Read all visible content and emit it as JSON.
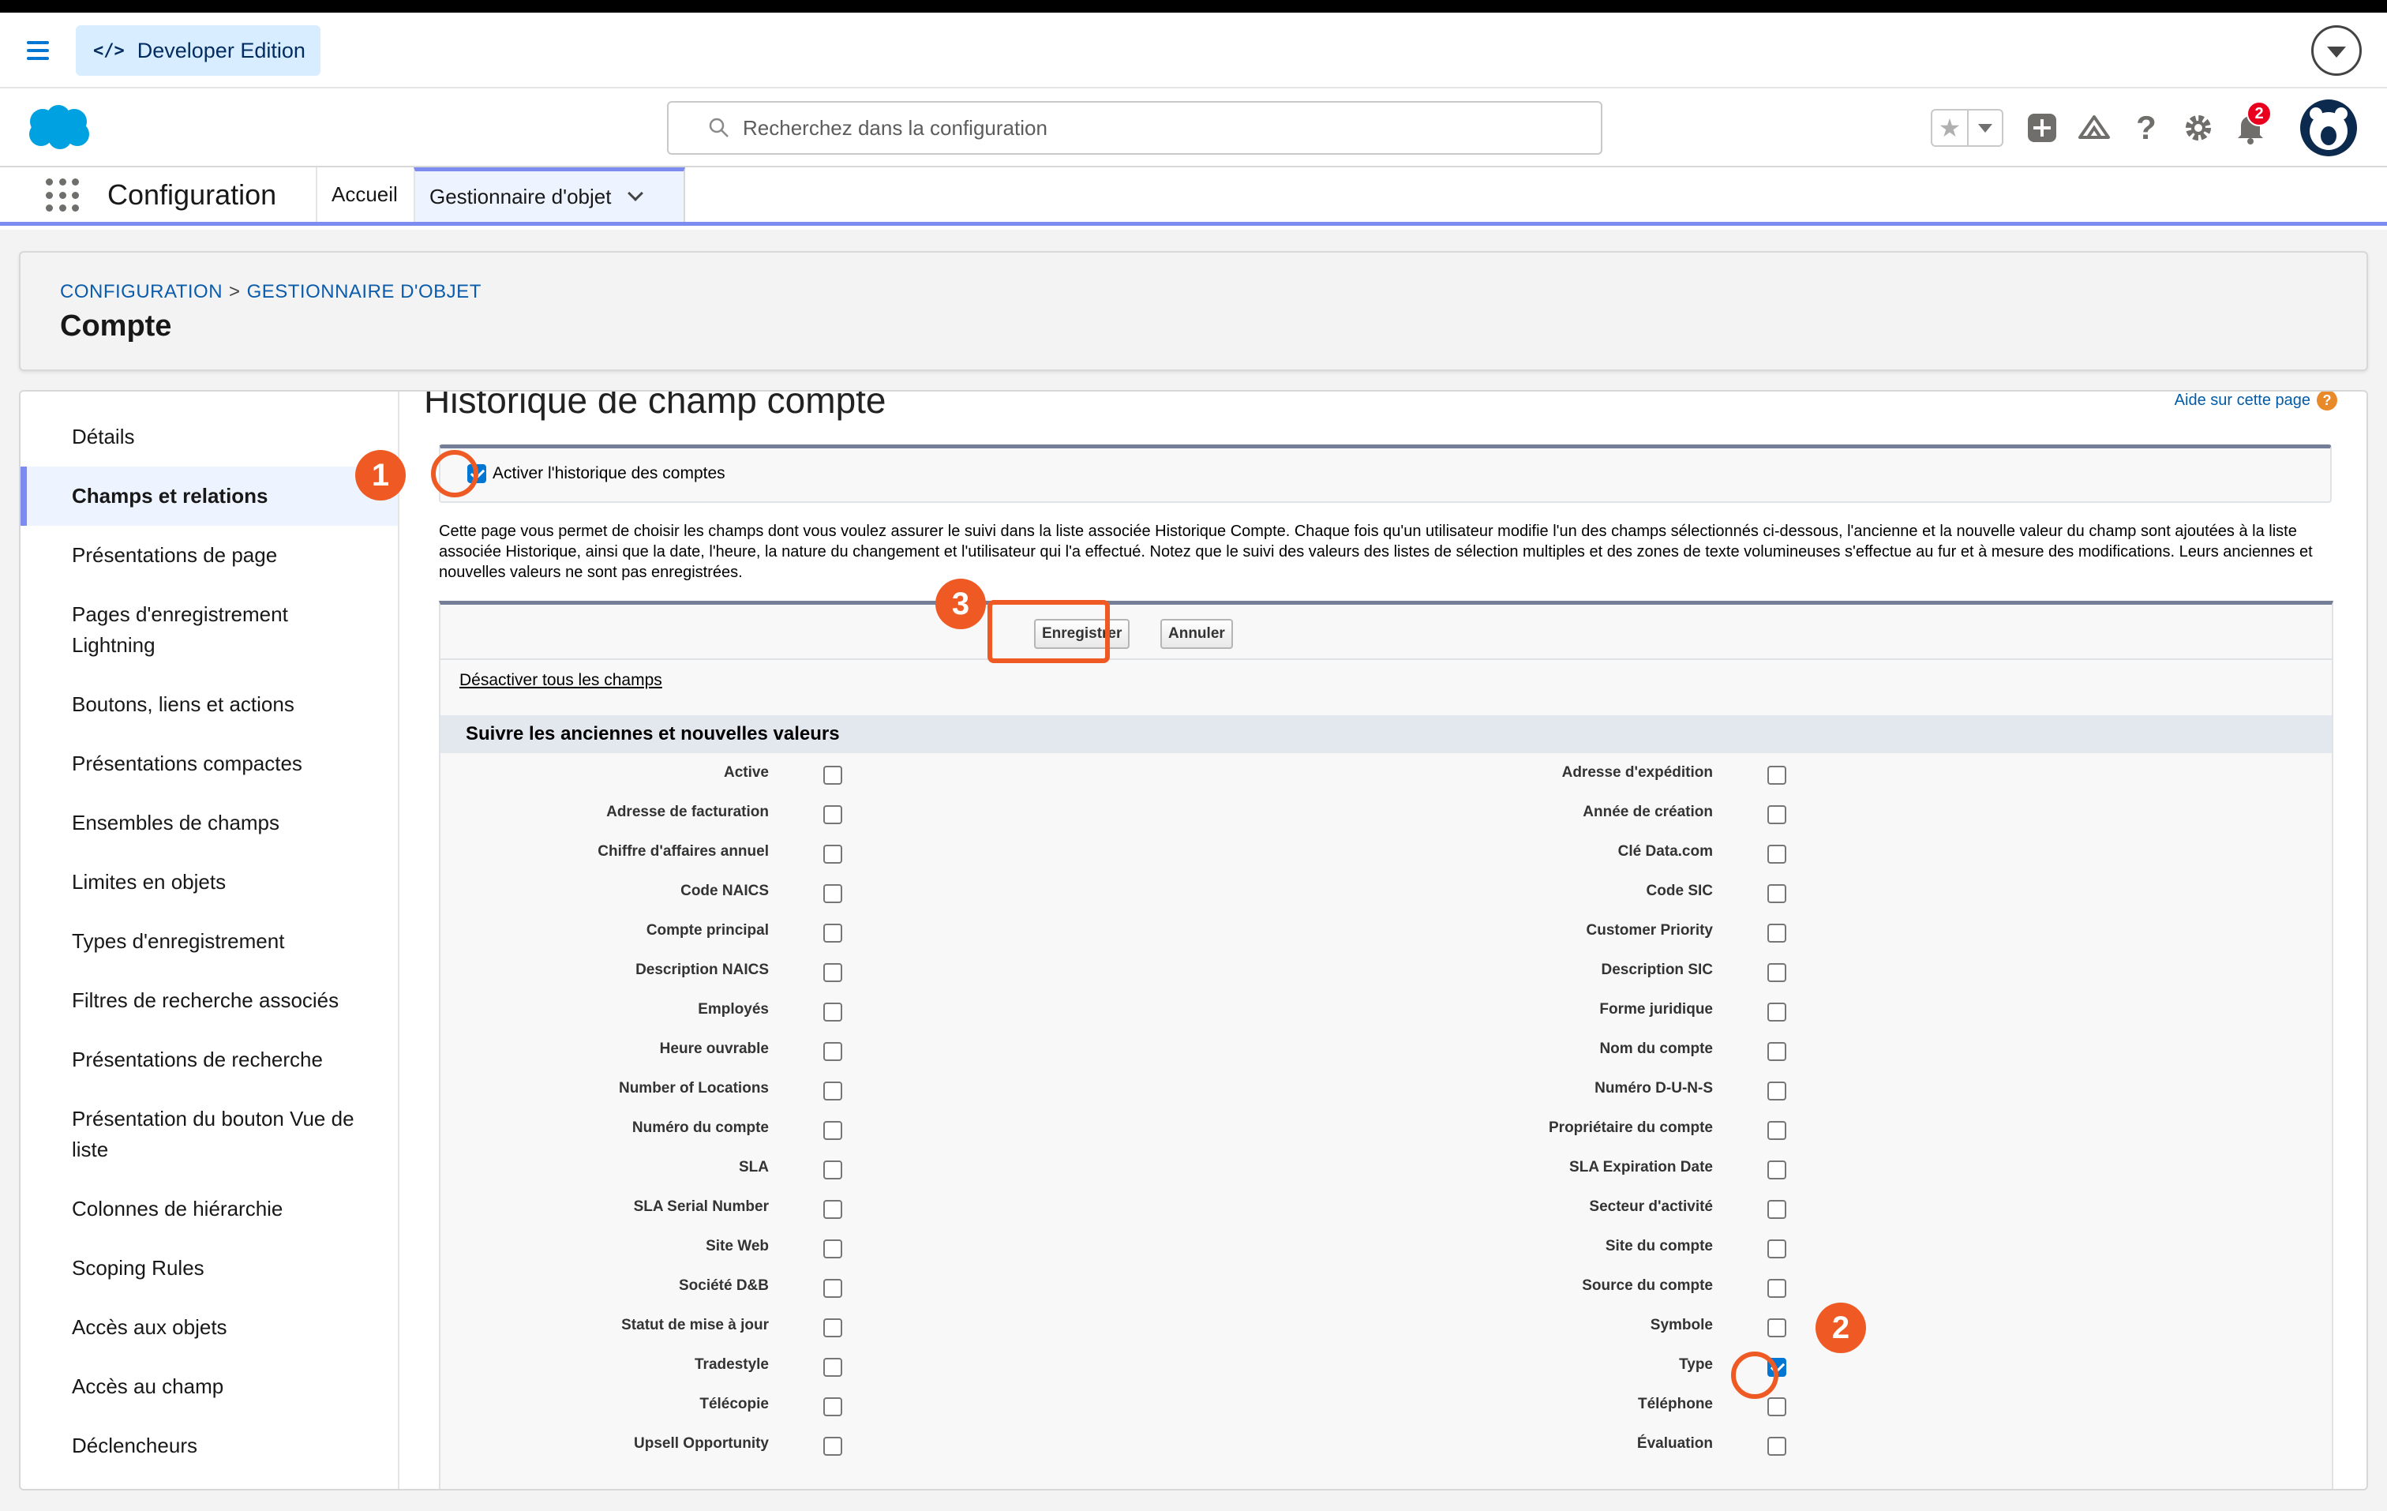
{
  "header": {
    "edition_badge": "Developer Edition",
    "search_placeholder": "Recherchez dans la configuration",
    "notification_count": "2"
  },
  "nav": {
    "app_name": "Configuration",
    "tabs": [
      {
        "label": "Accueil"
      },
      {
        "label": "Gestionnaire d'objet"
      }
    ]
  },
  "breadcrumb": {
    "items": [
      "CONFIGURATION",
      "GESTIONNAIRE D'OBJET"
    ],
    "separator": ">",
    "title": "Compte"
  },
  "sidebar": {
    "items": [
      {
        "label": "Détails"
      },
      {
        "label": "Champs et relations",
        "active": true
      },
      {
        "label": "Présentations de page"
      },
      {
        "label": "Pages d'enregistrement Lightning"
      },
      {
        "label": "Boutons, liens et actions"
      },
      {
        "label": "Présentations compactes"
      },
      {
        "label": "Ensembles de champs"
      },
      {
        "label": "Limites en objets"
      },
      {
        "label": "Types d'enregistrement"
      },
      {
        "label": "Filtres de recherche associés"
      },
      {
        "label": "Présentations de recherche"
      },
      {
        "label": "Présentation du bouton Vue de liste"
      },
      {
        "label": "Colonnes de hiérarchie"
      },
      {
        "label": "Scoping Rules"
      },
      {
        "label": "Accès aux objets"
      },
      {
        "label": "Accès au champ"
      },
      {
        "label": "Déclencheurs"
      }
    ]
  },
  "main": {
    "title": "Historique de champ compte",
    "help_link": "Aide sur cette page",
    "enable_history_label": "Activer l'historique des comptes",
    "enable_history_checked": true,
    "description": "Cette page vous permet de choisir les champs dont vous voulez assurer le suivi dans la liste associée Historique Compte. Chaque fois qu'un utilisateur modifie l'un des champs sélectionnés ci-dessous, l'ancienne et la nouvelle valeur du champ sont ajoutées à la liste associée Historique, ainsi que la date, l'heure, la nature du changement et l'utilisateur qui l'a effectué. Notez que le suivi des valeurs des listes de sélection multiples et des zones de texte volumineuses s'effectue au fur et à mesure des modifications. Leurs anciennes et nouvelles valeurs ne sont pas enregistrées.",
    "save_button": "Enregistrer",
    "cancel_button": "Annuler",
    "deactivate_all_link": "Désactiver tous les champs",
    "section_title": "Suivre les anciennes et nouvelles valeurs",
    "fields_left": [
      {
        "label": "Active",
        "checked": false
      },
      {
        "label": "Adresse de facturation",
        "checked": false
      },
      {
        "label": "Chiffre d'affaires annuel",
        "checked": false
      },
      {
        "label": "Code NAICS",
        "checked": false
      },
      {
        "label": "Compte principal",
        "checked": false
      },
      {
        "label": "Description NAICS",
        "checked": false
      },
      {
        "label": "Employés",
        "checked": false
      },
      {
        "label": "Heure ouvrable",
        "checked": false
      },
      {
        "label": "Number of Locations",
        "checked": false
      },
      {
        "label": "Numéro du compte",
        "checked": false
      },
      {
        "label": "SLA",
        "checked": false
      },
      {
        "label": "SLA Serial Number",
        "checked": false
      },
      {
        "label": "Site Web",
        "checked": false
      },
      {
        "label": "Société D&B",
        "checked": false
      },
      {
        "label": "Statut de mise à jour",
        "checked": false
      },
      {
        "label": "Tradestyle",
        "checked": false
      },
      {
        "label": "Télécopie",
        "checked": false
      },
      {
        "label": "Upsell Opportunity",
        "checked": false
      }
    ],
    "fields_right": [
      {
        "label": "Adresse d'expédition",
        "checked": false
      },
      {
        "label": "Année de création",
        "checked": false
      },
      {
        "label": "Clé Data.com",
        "checked": false
      },
      {
        "label": "Code SIC",
        "checked": false
      },
      {
        "label": "Customer Priority",
        "checked": false
      },
      {
        "label": "Description SIC",
        "checked": false
      },
      {
        "label": "Forme juridique",
        "checked": false
      },
      {
        "label": "Nom du compte",
        "checked": false
      },
      {
        "label": "Numéro D-U-N-S",
        "checked": false
      },
      {
        "label": "Propriétaire du compte",
        "checked": false
      },
      {
        "label": "SLA Expiration Date",
        "checked": false
      },
      {
        "label": "Secteur d'activité",
        "checked": false
      },
      {
        "label": "Site du compte",
        "checked": false
      },
      {
        "label": "Source du compte",
        "checked": false
      },
      {
        "label": "Symbole",
        "checked": false
      },
      {
        "label": "Type",
        "checked": true
      },
      {
        "label": "Téléphone",
        "checked": false
      },
      {
        "label": "Évaluation",
        "checked": false
      }
    ]
  },
  "annotations": {
    "step1": "1",
    "step2": "2",
    "step3": "3",
    "color": "#ef5a24"
  },
  "colors": {
    "brand_blue": "#0176d3",
    "nav_accent": "#7c8cf0",
    "link_blue": "#0b5cab"
  }
}
